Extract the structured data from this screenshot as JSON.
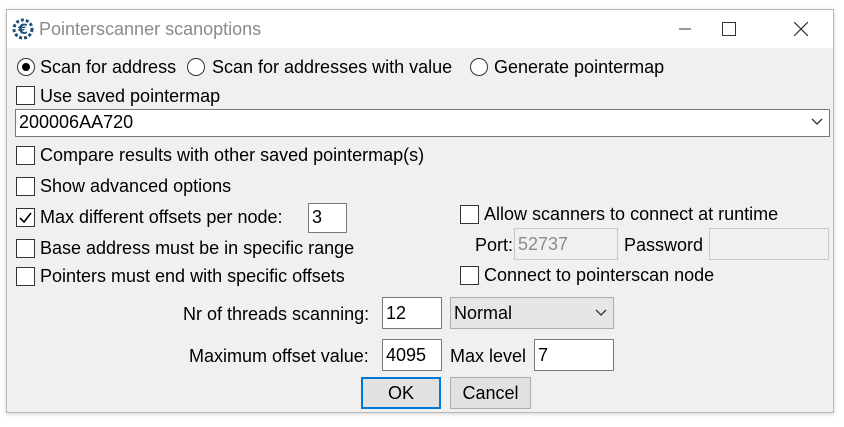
{
  "window": {
    "title": "Pointerscanner scanoptions"
  },
  "scan_mode": {
    "options": [
      "Scan for address",
      "Scan for addresses with value",
      "Generate pointermap"
    ],
    "selected": "Scan for address"
  },
  "use_saved_pointermap": {
    "label": "Use saved pointermap",
    "checked": false
  },
  "address_combo": {
    "value": "200006AA720"
  },
  "compare_results": {
    "label": "Compare results with other saved pointermap(s)",
    "checked": false
  },
  "show_advanced": {
    "label": "Show advanced options",
    "checked": false
  },
  "max_offsets": {
    "label": "Max different offsets per node:",
    "checked": true,
    "value": "3"
  },
  "base_address_range": {
    "label": "Base address must be in specific range",
    "checked": false
  },
  "pointers_end_offsets": {
    "label": "Pointers must end with specific offsets",
    "checked": false
  },
  "network": {
    "allow_connect_label": "Allow scanners to connect at runtime",
    "allow_connect_checked": false,
    "port_label": "Port:",
    "port_value": "52737",
    "password_label": "Password",
    "password_value": "",
    "connect_node_label": "Connect to pointerscan node",
    "connect_node_checked": false
  },
  "threads": {
    "label": "Nr of threads scanning:",
    "value": "12",
    "priority": "Normal"
  },
  "max_offset": {
    "label": "Maximum offset value:",
    "value": "4095"
  },
  "max_level": {
    "label": "Max level",
    "value": "7"
  },
  "buttons": {
    "ok": "OK",
    "cancel": "Cancel"
  }
}
